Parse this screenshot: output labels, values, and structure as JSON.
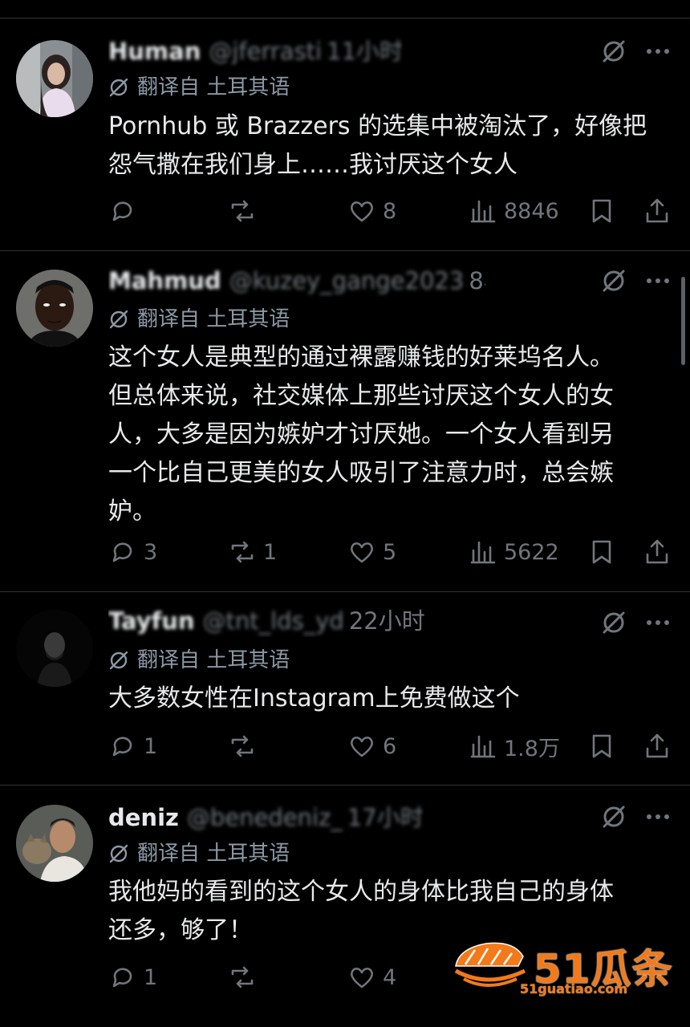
{
  "posts": [
    {
      "name": "Human",
      "handle": "@jferrasti",
      "time": "11小时",
      "translate": "翻译自 土耳其语",
      "text": "Pornhub 或 Brazzers 的选集中被淘汰了，好像把\n怨气撒在我们身上……我讨厌这个女人",
      "replies": "",
      "reposts": "",
      "likes": "8",
      "views": "8846"
    },
    {
      "name": "Mahmud",
      "handle": "@kuzey_gange2023",
      "time": "8小时",
      "translate": "翻译自 土耳其语",
      "text": "这个女人是典型的通过裸露赚钱的好莱坞名人。\n但总体来说，社交媒体上那些讨厌这个女人的女\n人，大多是因为嫉妒才讨厌她。一个女人看到另\n一个比自己更美的女人吸引了注意力时，总会嫉\n妒。",
      "replies": "3",
      "reposts": "1",
      "likes": "5",
      "views": "5622"
    },
    {
      "name": "Tayfun",
      "handle": "@tnt_lds_yd",
      "time": "22小时",
      "translate": "翻译自 土耳其语",
      "text": "大多数女性在Instagram上免费做这个",
      "replies": "1",
      "reposts": "",
      "likes": "6",
      "views": "1.8万"
    },
    {
      "name": "deniz",
      "handle": "@benedeniz_",
      "time": "17小时",
      "translate": "翻译自 土耳其语",
      "text": "我他妈的看到的这个女人的身体比我自己的身体\n还多，够了！",
      "replies": "1",
      "reposts": "",
      "likes": "4",
      "views": ""
    }
  ],
  "icons": {
    "grok": "grok-icon",
    "more": "more-icon",
    "translate": "translate-icon",
    "reply": "reply-icon",
    "repost": "repost-icon",
    "like": "like-icon",
    "views": "views-icon",
    "bookmark": "bookmark-icon",
    "share": "share-icon"
  },
  "watermark": {
    "brand": "51瓜条",
    "url": "51guatiao.com"
  },
  "colors": {
    "background": "#000000",
    "text": "#e7e9ea",
    "muted": "#71767b",
    "divider": "#2f3336",
    "watermark": "#f27a1a"
  }
}
